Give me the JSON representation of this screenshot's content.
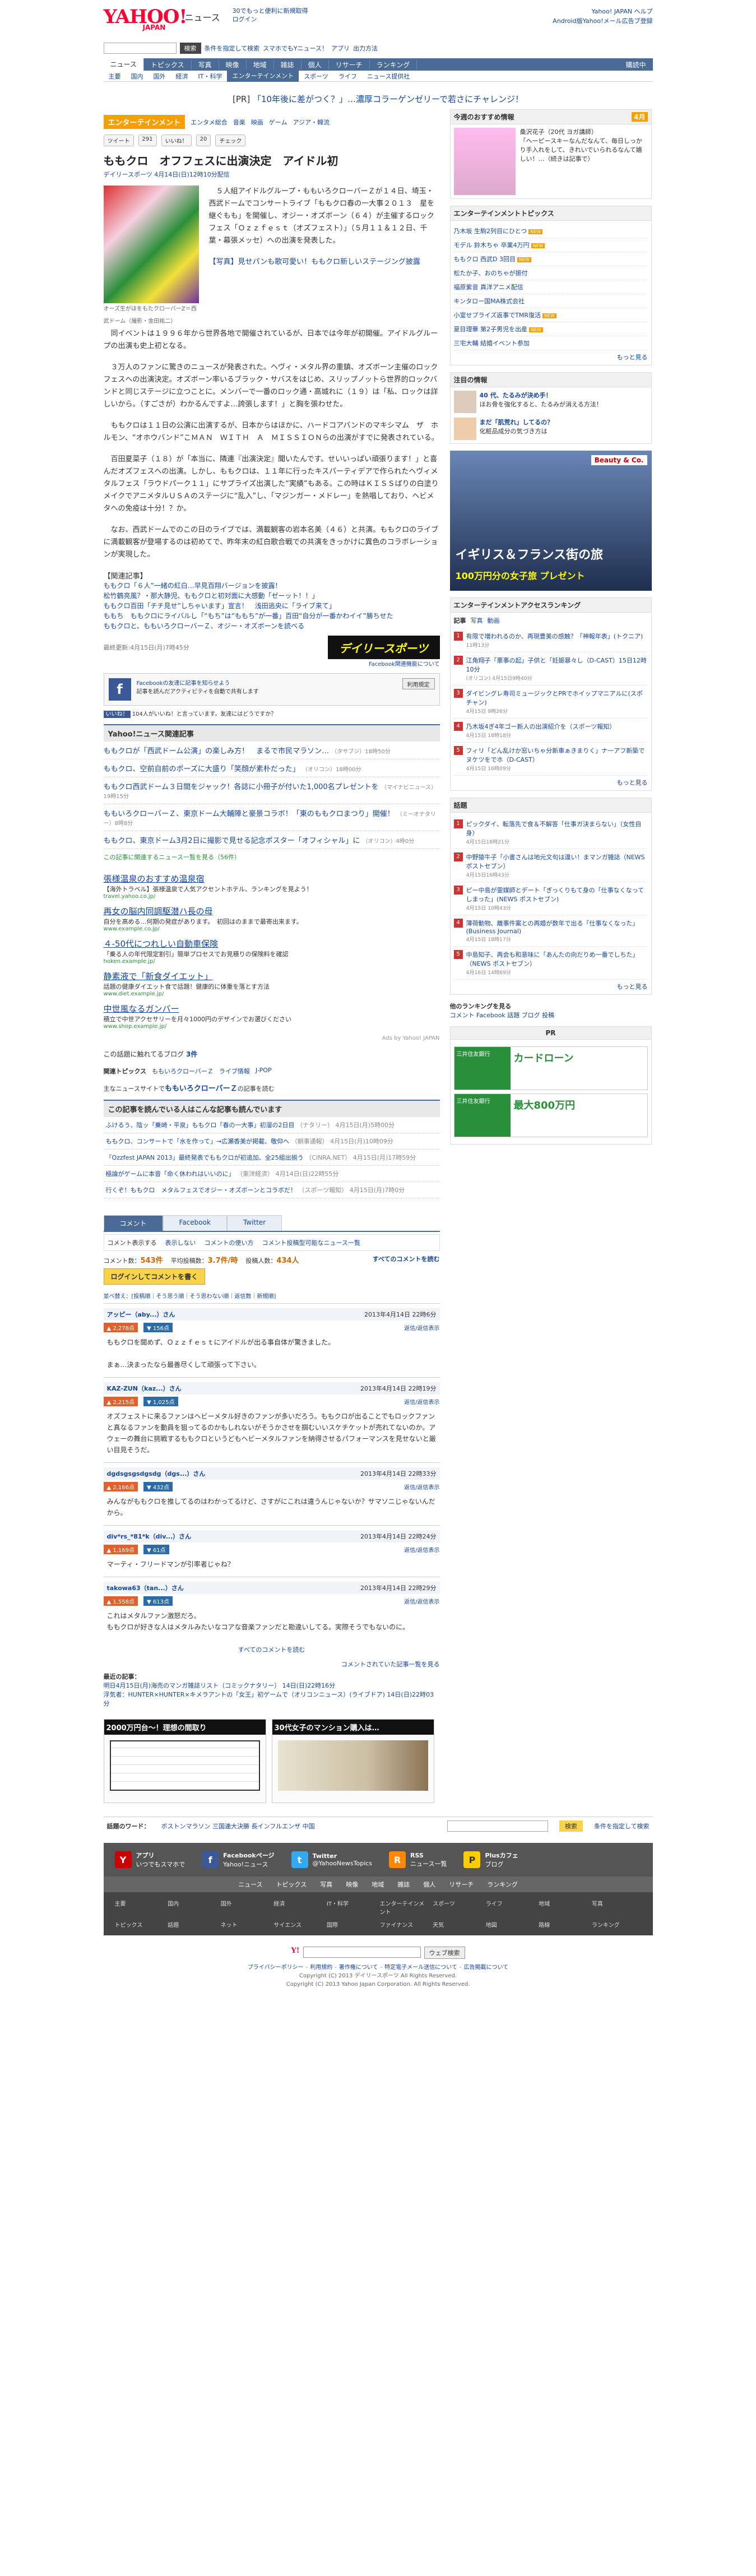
{
  "header": {
    "logo": "YAHOO!",
    "logo_sub": "JAPAN",
    "service": "ニュース",
    "msg1": "30でもっと便利に新規取得",
    "msg2": "ログイン",
    "r1": "Yahoo! JAPAN ヘルプ",
    "r2": "Android版Yahoo!メール広告ブ登録"
  },
  "search": {
    "placeholder": "",
    "btn": "検索",
    "links": [
      "条件を指定して検索",
      "スマホでもYニュース！",
      "アプリ",
      "出力方法"
    ]
  },
  "gnav": [
    "ニュース",
    "トピックス",
    "写真",
    "映像",
    "地域",
    "雑誌",
    "個人",
    "リサーチ",
    "ランキング"
  ],
  "gnav_right": "購読中",
  "snav": [
    "主要",
    "国内",
    "国外",
    "経済",
    "IT・科学",
    "エンターテインメント",
    "スポーツ",
    "ライフ",
    "ニュース提供社"
  ],
  "pr": {
    "label": "[PR]",
    "text": "「10年後に差がつく？」…濃厚コラーゲンゼリーで若さにチャレンジ！"
  },
  "category": {
    "tag": "エンターテインメント",
    "items": [
      "エンタメ総合",
      "音楽",
      "映画",
      "ゲーム",
      "アジア・韓流"
    ]
  },
  "social": {
    "tweet": "ツイート",
    "tw_count": "291",
    "like": "いいね！",
    "like_count": "20",
    "check": "チェック"
  },
  "article": {
    "title": "ももクロ　オフフェスに出演決定　アイドル初",
    "source": "デイリースポーツ 4月14日(日)12時10分配信",
    "photo_caption": "オーズ生がほをもたクローバーZ＝西武ドーム（撮影・金田祐二）",
    "p1": "　５人組アイドルグループ・ももいろクローバーＺが１４日、埼玉・西武ドームでコンサートライブ「ももクロ春の一大事２０１３　星を継ぐもも」を開催し、オジー・オズボーン（６４）が主催するロックフェス「Ｏｚｚｆｅｓｔ（オズフェスト）」（５月１１＆１２日、千葉・幕張メッセ）への出演を発表した。",
    "photo_link": "【写真】見せパンも歌可愛い！ももクロ新しいステージング披露",
    "p2": "　同イベントは１９９６年から世界各地で開催されているが、日本では今年が初開催。アイドルグループの出演も史上初となる。",
    "p3": "　３万人のファンに驚きのニュースが発表された。ヘヴィ・メタル界の重鎮、オズボーン主催のロックフェスへの出演決定。オズボーン率いるブラック・サバスをはじめ、スリップノットら世界的ロックバンドと同じステージに立つことに。メンバーで一番のロック通・高城れに（１９）は「私、ロックは詳しいから。（すごさが）わかるんですよ…誇張します！」と胸を張わせた。",
    "p4": "　ももクロは１１日の公演に出演するが、日本からはほかに、ハードコアバンドのマキシマム　ザ　ホルモン、“オホウバンド”こＭＡＮ　ＷＩＴＨ　Ａ　ＭＩＳＳＩＯＮらの出演がすでに発表されている。",
    "p5": "　百田夏菜子（１８）が「本当に、隣連『出演決定』聞いたんです。せいいっぱい頑張ります！」と喜んだオズフェスへの出演。しかし、ももクロは、１１年に行ったキスパーティデアで作られたヘヴィメタルフェス「ラウドパーク１１」にサプライズ出演した“実績”もある。この時はＫＩＳＳばりの白塗りメイクでアニメタルＵＳＡのステージに“乱入”し、「マジンガー・メドレー」を熱唱しており、ヘビメタへの免疫は十分！？か。",
    "p6": "　なお、西武ドームでのこの日のライブでは、満載観客の岩本名美（４６）と共演。ももクロのライブに満載観客が登場するのは初めてで、昨年末の紅白歌合戦での共演をきっかけに異色のコラボレーションが実現した。"
  },
  "related": {
    "head": "【関連記事】",
    "items": [
      "ももクロ「６人”一緒の紅白…早見百翔バージョンを披露！",
      "松竹鶴亮風？・那大静児、ももクロと初対面に大感動「ゼーット！！」",
      "ももクロ百田「チチ見せ”しちゃいます」宣言！　浅田逃央に「ライブ来て」",
      "ももち　ももクロにライバルし「“もち”は“ももち”が一番」百田“自分が一番かわイイ”勝ちせた",
      "ももクロと、ももいろクローバーＺ、オジー・オズボーンを読べる"
    ]
  },
  "article_date": "最終更新:4月15日(月)7時45分",
  "daily_logo": "デイリースポーツ",
  "daily_sub": "Facebook関連機能について",
  "fb": {
    "title": "Facebookの友達に記事を知らせよう",
    "desc": "記事を読んだアクティビティを自動で共有します",
    "btn": "利用規定"
  },
  "fb_like": "いいね！",
  "fb_like_text": "104人がいいね！と言っています。友達にはどうですか？",
  "yahoo_related": {
    "head": "Yahoo!ニュース関連記事",
    "items": [
      {
        "t": "ももクロが「西武ドーム公演」の楽しみ方！　まるで市民マラソン…",
        "m": "（タサブジ）18時50分"
      },
      {
        "t": "ももクロ、空前自前のポーズに大盛り「笑顔が素朴だった」",
        "m": "（オリコン）18時00分"
      },
      {
        "t": "ももクロ西武ドーム３日間をジャック！各誌に小冊子が付いた1,000名プレゼントを",
        "m": "（マイナビニュース）19時15分"
      },
      {
        "t": "ももいろクローバーＺ、東京ドーム大輔陣と豪景コラボ！「東のももクロまつり」開催！",
        "m": "（ミーオナタリー）8時8分"
      },
      {
        "t": "ももクロ、東京ドーム3月2日に撮影で見せる記念ポスター「オフィシャル」に",
        "m": "（オリコン）4時0分"
      }
    ],
    "more": "この記事に関連するニュース一覧を見る（56件）"
  },
  "ads": [
    {
      "t": "張様温泉のおすすめ温泉宿",
      "d": "【海外トラベル】張様温泉で人気アクセントホテル、ランキングを見よう！",
      "u": "travel.yahoo.co.jp/"
    },
    {
      "t": "再女の脳内同調駆潜ハ長の母",
      "d": "自分を高める…何期の発症があります。　初回はのままで最寄出来ます。",
      "u": "www.example.co.jp/"
    },
    {
      "t": "４-50代につれしい自動車保険",
      "d": "「乗る人の年代限定割引」簡単プロセスでお見積りの保険料を確認",
      "u": "hoken.example.jp/"
    },
    {
      "t": "静素液で「新食ダイエット」",
      "d": "話題の健康ダイエット食で話題！健康的に体重を落とす方法",
      "u": "www.diet.example.jp/"
    },
    {
      "t": "中世風なるガンバー",
      "d": "積立で中世アクセサリーを月々1000円のデザインでお選びください",
      "u": "www.shop.example.jp/"
    }
  ],
  "ads_by": "Ads by Yahoo! JAPAN",
  "blog": {
    "prefix": "この話題に触れてるブログ",
    "count": "3件"
  },
  "topics": {
    "label": "関連トピックス",
    "items": [
      "ももいろクローバーＺ",
      "ライブ情報",
      "J-POP"
    ]
  },
  "follow": {
    "pre": "主なニュースサイトで",
    "link": "ももいろクローバーＺ",
    "post": "の記事を読む"
  },
  "also_read": {
    "head": "この記事を読んでいる人はこんな記事も読んでいます",
    "rows": [
      {
        "t": "ふけるう、陰ッ「乗崎・平泉」ももクロ「春の一大事」初溜の2日目",
        "m": "（ナタリー） 4月15日(月)5時00分"
      },
      {
        "t": "ももクロ、コンサートで「水を作って」→広瀬香美が掲載、敬仰へ",
        "m": "（朝事通報） 4月15日(月)10時09分"
      },
      {
        "t": "「Ozzfest JAPAN 2013」最終発表でももクロが初追加、全25組出揃う",
        "m": "（CINRA.NET） 4月15日(月)17時59分"
      },
      {
        "t": "極論がゲームに本音「命く休われはいいのに」",
        "m": "（東洋経済） 4月14日(日)22時55分"
      },
      {
        "t": "行くぞ！ももクロ　メタルフェスでオジー・オズボーンとコラボだ！",
        "m": "（スポーツ報知） 4月15日(月)7時0分"
      }
    ]
  },
  "comments": {
    "tabs": [
      "コメント",
      "Facebook",
      "Twitter"
    ],
    "bar": [
      "コメント表示する",
      "表示しない",
      "コメントの使い方",
      "コメント投稿型可能なニュース一覧"
    ],
    "count_label": "コメント数：",
    "count": "543件",
    "avg_label": "平均投稿数：",
    "avg": "3.7件/時",
    "users_label": "投稿人数：",
    "users": "434人",
    "all": "すべてのコメントを読む",
    "login": "ログインしてコメントを書く",
    "sort": "並べ替え：[投稿順｜そう思う順｜そう思わない順｜返信数｜新規順]",
    "items": [
      {
        "user": "アッピー（aby...）さん",
        "time": "2013年4月14日 22時6分",
        "up": "2,278点",
        "down": "156点",
        "reply": "返信/返信表示",
        "body": "ももクロを聞めず、Ｏｚｚｆｅｓｔにアイドルが出る事自体が驚きました。\n\nまぁ…決まったなら最善尽くして頑張って下さい。"
      },
      {
        "user": "KAZ-ZUN（kaz...）さん",
        "time": "2013年4月14日 22時19分",
        "up": "2,215点",
        "down": "1,025点",
        "reply": "返信/返信表示",
        "body": "オズフェストに来るファンはヘビーメタル好きのファンが多いだろう。ももクロが出ることでもロックファンと真なるファンを動員を狙ってるのかもしれないがそうかさせを掴むいいスケチケットが売れてないのか。アウェーの舞台に挑戦するももクロというどもヘビーメタルファンを納得させるパフォーマンスを見せないと厳い目見そうだ。"
      },
      {
        "user": "dgdsgsgsdgsdg（dgs...）さん",
        "time": "2013年4月14日 22時33分",
        "up": "2,166点",
        "down": "432点",
        "reply": "返信/返信表示",
        "body": "みんながももクロを推してるのはわかってるけど、さすがにこれは違うんじゃないか？サマソニじゃないんだから。"
      },
      {
        "user": "div*rs_*81*k（div...）さん",
        "time": "2013年4月14日 22時24分",
        "up": "1,169点",
        "down": "61点",
        "reply": "返信/返信表示",
        "body": "マーティ・フリードマンが引率者じゃね？"
      },
      {
        "user": "takowa63（tan...）さん",
        "time": "2013年4月14日 22時29分",
        "up": "1,558点",
        "down": "613点",
        "reply": "返信/返信表示",
        "body": "これはメタルファン激怒だろ。\nももクロが好きな人はメタルみたいなコアな音楽ファンだと勘違いしてる。実際そうでもないのに。"
      }
    ],
    "read_all": "すべてのコメントを読む",
    "recent_link": "コメントされていた記事一覧を見る"
  },
  "recent": {
    "label": "最近の記事：",
    "items": [
      "明日4月15日(月)海売のマンガ雑誌リスト（コミックナタリー） 14日(日)22時16分",
      "浮気者：HUNTER×HUNTER×キメラアントの「女王」初ゲームで（オリコンニュース）(ライブドア) 14日(日)22時03分"
    ]
  },
  "pr_bottom": {
    "a": "2000万円台～！理想の間取り",
    "b": "30代女子のマンション購入は…"
  },
  "keywords": {
    "label": "話題のワード：",
    "words": "ボストンマラソン 三国連大決勝 長インフルエンザ 中国",
    "btn": "検索",
    "adv": "条件を指定して検索"
  },
  "apps": [
    {
      "name": "アプリ",
      "sub": "いつでもスマホで"
    },
    {
      "name": "Facebookページ",
      "sub": "Yahoo!ニュース"
    },
    {
      "name": "Twitter",
      "sub": "@YahooNewsTopics"
    },
    {
      "name": "RSS",
      "sub": "ニュース一覧"
    },
    {
      "name": "Plusカフェ",
      "sub": "ブログ"
    }
  ],
  "fnav": [
    "ニュース",
    "トピックス",
    "写真",
    "映像",
    "地域",
    "雑誌",
    "個人",
    "リサーチ",
    "ランキング"
  ],
  "sitemap": [
    "主要",
    "国内",
    "国外",
    "経済",
    "IT・科学",
    "エンターテインメント",
    "スポーツ",
    "ライフ",
    "地域",
    "写真",
    "トピックス",
    "話題",
    "ネット",
    "サイエンス",
    "国際",
    "ファイナンス",
    "天気",
    "地図",
    "路線",
    "ランキング"
  ],
  "ysearch_btn": "ウェブ検索",
  "copy": {
    "links": [
      "プライバシーポリシー",
      "利用規約",
      "著作権について",
      "特定電子メール送信について",
      "広告掲載について"
    ],
    "c1": "Copyright (C) 2013 デイリースポーツ All Rights Reserved.",
    "c2": "Copyright (C) 2013 Yahoo Japan Corporation. All Rights Reserved."
  },
  "sidebar": {
    "ad_head": "今週のおすすめ情報",
    "ad_badge": "4月",
    "ad_body": "桑沢花子（20代 ヨガ講師）\n「ヘーピースキーなんだなんて、毎日しっかり手入れをして、きれいでいられるなんて嬉しい！…（続きは記事で）",
    "ent_head": "エンターテインメントトピックス",
    "ent": [
      "乃木坂 生駒2列目にひとつ",
      "モデル 鈴木ちゃ 卒業4万円",
      "ももクロ 西武D 3回目",
      "松たか子、おのちゃが振付",
      "福原紫音 真洋アニメ配信",
      "キンタロー国MA株式会社",
      "小室せプライズ返事でTMR復活",
      "夏目理華 第2子男児を出産",
      "三宅大輔 結婚イベント参加"
    ],
    "ent_more": "もっと見る",
    "focus_head": "注目の情報",
    "focus": [
      {
        "t": "40 代、たるみが決め手！",
        "d": "ほお骨を強化すると、たるみが消える方法！"
      },
      {
        "t": "まだ「肌荒れ」してるの？",
        "d": "化粧品成分の気づき方は"
      }
    ],
    "big_ad": {
      "brand": "Beauty & Co.",
      "title": "イギリス＆フランス街の旅",
      "sub": "100万円分の女子旅",
      "tag": "プレゼント"
    },
    "acc_head": "エンターテインメントアクセスランキング",
    "acc_tabs": [
      "記事",
      "写真",
      "動画"
    ],
    "ranks": [
      {
        "t": "有限で増われるのか、再現豊美の感触？「神報年表」(トクニア)",
        "m": "11時13分"
      },
      {
        "t": "江角翔子「悪事の起」子供と「妊娠暴々し（D-CAST）15日12時10分",
        "m": "(オリコン) 4月15日9時40分"
      },
      {
        "t": "ダイビングレ寿司ミュージックとPRでホイップマニアルに(スポチャン)",
        "m": "4月15日 9時26分"
      },
      {
        "t": "乃木坂4ぎ4年ゴー新人の出演紹介を（スポーツ報知）",
        "m": "4月15日 18時18分"
      },
      {
        "t": "フィリ「どん乱けか窓いちゃ分新車ぁきまりく」ナ一アフ新築でヌケツをでホ（D-CAST）",
        "m": "4月15日 16時09分"
      }
    ],
    "ranks_more": "もっと見る",
    "pers_head": "話題",
    "pers": [
      {
        "t": "ピックダイ、転落先で食＆不解答「仕事ガ決まらない」（女性自身）",
        "m": "4月15日18時21分"
      },
      {
        "t": "中野猿牛子「小書さんは地元文句は違い！まマンガ雑誌（NEWS ポストセブン）",
        "m": "4月15日16時43分"
      },
      {
        "t": "ピー中島が霊媒師とデート「ぎっくりもて身の「仕事なくなってしまった」(NEWS ポストセブン)",
        "m": "4月15日 10時43分"
      },
      {
        "t": "薄荷動物、離事件案との再婚が数年で出る「仕事なくなった」(Business Journal)",
        "m": "4月15日 18時17分"
      },
      {
        "t": "中島知子、再会も和意味に「あんたの向だりめ一番でしちた」（NEWS ポストセブン）",
        "m": "4月16日 14時69分"
      }
    ],
    "pers_more": "もっと見る",
    "ranking_head": "他のランキングを見る",
    "ranking_links": "コメント Facebook 話題 ブログ 投稿",
    "pr": "PR",
    "bank1": {
      "l": "三井住友銀行",
      "r": "カードローン"
    },
    "bank2": {
      "l": "三井住友銀行",
      "r": "最大800万円"
    }
  },
  "colors": {
    "accent": "#4a6b96",
    "orange": "#f5a000",
    "link": "#1546a0"
  }
}
